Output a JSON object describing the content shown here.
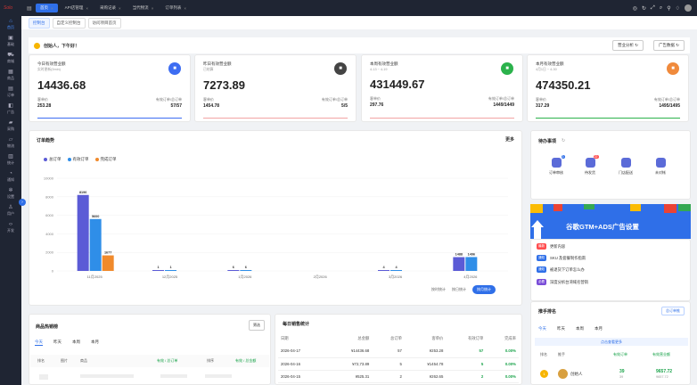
{
  "topbar": {
    "logo": "Solo",
    "tabs": [
      {
        "label": "首页",
        "active": true
      },
      {
        "label": "API店管理"
      },
      {
        "label": "采购记录"
      },
      {
        "label": "当代物流"
      },
      {
        "label": "订单列表"
      }
    ]
  },
  "sidebar": {
    "items": [
      {
        "label": "首页",
        "icon": "home-icon",
        "active": true
      },
      {
        "label": "基础",
        "icon": "cube-icon"
      },
      {
        "label": "商城",
        "icon": "cart-icon"
      },
      {
        "label": "商品",
        "icon": "box-icon"
      },
      {
        "label": "订单",
        "icon": "doc-icon"
      },
      {
        "label": "广告",
        "icon": "ad-icon"
      },
      {
        "label": "采购",
        "icon": "truck-icon"
      },
      {
        "label": "物流",
        "icon": "van-icon"
      },
      {
        "label": "统计",
        "icon": "chart-icon"
      },
      {
        "label": "通知",
        "icon": "bell-icon"
      },
      {
        "label": "设置",
        "icon": "gear-icon"
      },
      {
        "label": "用户",
        "icon": "user-icon"
      },
      {
        "label": "开发",
        "icon": "code-icon"
      }
    ]
  },
  "breadtabs": [
    {
      "label": "控制台",
      "active": true
    },
    {
      "label": "自定义控制台"
    },
    {
      "label": "访问项目首页"
    }
  ],
  "greeting": "创始人，下午好！",
  "buttons": {
    "biz": "营业分析",
    "ad": "广告数据"
  },
  "cards": [
    {
      "title": "今日有效营业额",
      "sub": "实时更新(5min)",
      "value": "14436.68",
      "l_label": "客单价",
      "l_value": "253.28",
      "r_label": "有效订单/总订单",
      "r_value": "57/57",
      "color": "#3d6df2"
    },
    {
      "title": "昨日有效营业额",
      "sub": "已结算",
      "value": "7273.89",
      "l_label": "客单价",
      "l_value": "1454.78",
      "r_label": "有效订单/总订单",
      "r_value": "5/5",
      "color": "#444444"
    },
    {
      "title": "本周有效营业额",
      "sub": "4-13 ~ 4-19",
      "value": "431449.67",
      "l_label": "客单价",
      "l_value": "297.76",
      "r_label": "有效订单/总订单",
      "r_value": "1449/1449",
      "color": "#2bb24c"
    },
    {
      "title": "本月有效营业额",
      "sub": "4月1日 ~ 4-30",
      "value": "474350.21",
      "l_label": "客单价",
      "l_value": "317.29",
      "r_label": "有效订单/总订单",
      "r_value": "1495/1495",
      "color": "#f08a3c"
    }
  ],
  "orders": {
    "title": "订单趋势",
    "more": "更多",
    "btns": [
      "按时统计",
      "按日统计",
      "按月统计"
    ]
  },
  "chart_data": {
    "type": "bar",
    "categories": [
      "11月2025",
      "12月2025",
      "1月2026",
      "2月2026",
      "3月2026",
      "4月2026"
    ],
    "series": [
      {
        "name": "总订单",
        "color": "#5b5bd6",
        "values": [
          8196,
          1,
          6,
          0,
          4,
          1488
        ]
      },
      {
        "name": "有效订单",
        "color": "#2f8ee8",
        "values": [
          5600,
          1,
          6,
          0,
          4,
          1496
        ]
      },
      {
        "name": "完成订单",
        "color": "#f08a2c",
        "values": [
          1677,
          0,
          0,
          0,
          0,
          0
        ]
      }
    ],
    "data_labels": [
      [
        "8196",
        "5600",
        "1677"
      ],
      [
        "1",
        "1",
        ""
      ],
      [
        "6",
        "6",
        ""
      ],
      [
        "",
        "",
        ""
      ],
      [
        "4",
        "4",
        ""
      ],
      [
        "1488",
        "1496",
        ""
      ]
    ],
    "yticks": [
      0,
      2000,
      4000,
      6000,
      8000,
      10000
    ],
    "ylim": [
      0,
      10000
    ]
  },
  "todo": {
    "title": "待办事项",
    "items": [
      {
        "label": "订单审核",
        "badge": "3",
        "blue": true
      },
      {
        "label": "待发货",
        "badge": "22"
      },
      {
        "label": "门店配送",
        "badge": ""
      },
      {
        "label": "未对帐",
        "badge": ""
      }
    ]
  },
  "banner": {
    "text": "谷歌GTM+ADS广告设置"
  },
  "news": [
    {
      "tag": "最新",
      "text": "更新内容",
      "color": "#ff4d4f"
    },
    {
      "tag": "通知",
      "text": "SKU 及套餐制作指南",
      "color": "#2f6fe8"
    },
    {
      "tag": "通知",
      "text": "被退货下订单怎么办",
      "color": "#2f6fe8"
    },
    {
      "tag": "必看",
      "text": "深度分拆台湾域名营销",
      "color": "#7a4dd8"
    }
  ],
  "sales": {
    "title": "商品热销榜",
    "btn": "筛选",
    "tabs": [
      "今天",
      "昨天",
      "本周",
      "本月"
    ],
    "cols": [
      "排名",
      "图片",
      "商品",
      "有效 / 总订单",
      "排序",
      "有效 / 总金额"
    ]
  },
  "daily": {
    "title": "每日销售统计",
    "cols": [
      "日期",
      "总金额",
      "总订单",
      "客单价",
      "有效订单",
      "完成率"
    ],
    "rows": [
      [
        "2026-04-17",
        "¥14436.68",
        "57",
        "¥253.28",
        "57",
        "0.00%"
      ],
      [
        "2026-04-16",
        "¥72,73.89",
        "5",
        "¥1454.78",
        "5",
        "0.00%"
      ],
      [
        "2026-04-15",
        "¥525.31",
        "2",
        "¥262.65",
        "2",
        "0.00%"
      ]
    ]
  },
  "rank": {
    "title": "推手排名",
    "btn": "总订单推",
    "tabs": [
      "今天",
      "昨天",
      "本周",
      "本月"
    ],
    "more": "点击查看更多",
    "cols": [
      "排名",
      "推手",
      "有效订单",
      "有效营业额"
    ],
    "row": {
      "rank": "1",
      "name": "创始人",
      "orders": "39",
      "orders_total": "39",
      "amount": "9657.72",
      "amount_total": "9657.72"
    }
  }
}
